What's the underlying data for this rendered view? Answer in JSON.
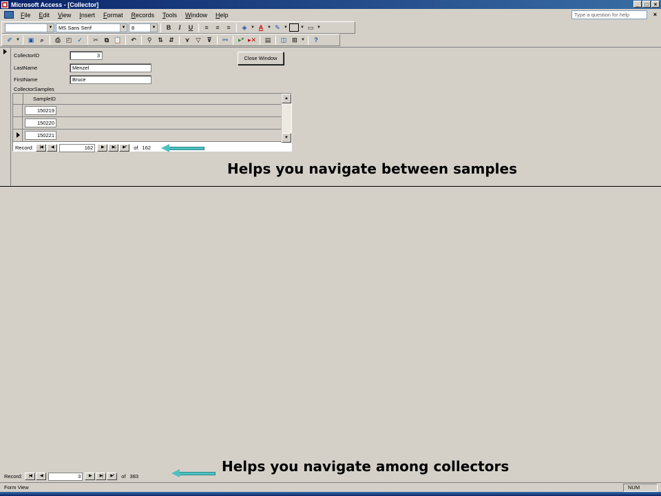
{
  "window": {
    "title": "Microsoft Access - [Collector]",
    "controls": [
      "_",
      "□",
      "×"
    ]
  },
  "menu": {
    "items": [
      "File",
      "Edit",
      "View",
      "Insert",
      "Format",
      "Records",
      "Tools",
      "Window",
      "Help"
    ],
    "help_placeholder": "Type a question for help",
    "close": "×"
  },
  "toolbar_format": {
    "object_combo": "",
    "font_name": "MS Sans Serif",
    "font_size": "8",
    "bold": "B",
    "italic": "I",
    "underline": "U"
  },
  "form": {
    "collector_id_label": "CollectorID",
    "collector_id_value": "3",
    "last_name_label": "LastName",
    "last_name_value": "Menzel",
    "first_name_label": "FirstName",
    "first_name_value": "Bruce",
    "close_button": "Close Window",
    "subform_label": "CollectorSamples"
  },
  "subform": {
    "column_header": "SampleID",
    "rows": [
      "150219",
      "150220",
      "150221"
    ],
    "nav": {
      "record_label": "Record:",
      "current": "162",
      "of_label": "of",
      "total": "162"
    }
  },
  "main_nav": {
    "record_label": "Record:",
    "current": "3",
    "of_label": "of",
    "total": "383"
  },
  "annotations": {
    "samples": "Helps you navigate between samples",
    "collectors": "Helps you navigate among collectors"
  },
  "status": {
    "view": "Form View",
    "num": "NUM"
  },
  "colors": {
    "title_start": "#0a246a",
    "title_end": "#3a6ea5",
    "arrow": "#4fc0c0",
    "window": "#d4d0c8"
  }
}
